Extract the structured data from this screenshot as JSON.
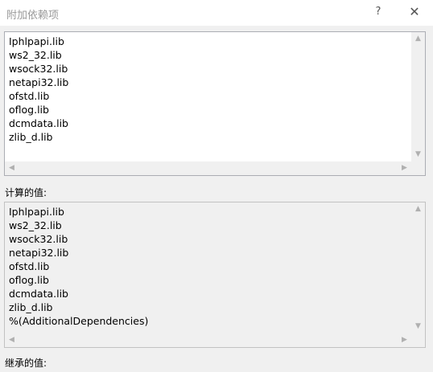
{
  "window": {
    "title": "附加依赖项",
    "help_glyph": "?",
    "close_glyph": "✕"
  },
  "edit_box": {
    "lines": [
      "Iphlpapi.lib",
      "ws2_32.lib",
      "wsock32.lib",
      "netapi32.lib",
      "ofstd.lib",
      "oflog.lib",
      "dcmdata.lib",
      "zlib_d.lib"
    ]
  },
  "evaluated": {
    "label": "计算的值:",
    "lines": [
      "Iphlpapi.lib",
      "ws2_32.lib",
      "wsock32.lib",
      "netapi32.lib",
      "ofstd.lib",
      "oflog.lib",
      "dcmdata.lib",
      "zlib_d.lib",
      "%(AdditionalDependencies)"
    ]
  },
  "inherited": {
    "label": "继承的值:"
  },
  "icons": {
    "up": "▲",
    "down": "▼",
    "left": "◀",
    "right": "▶"
  }
}
